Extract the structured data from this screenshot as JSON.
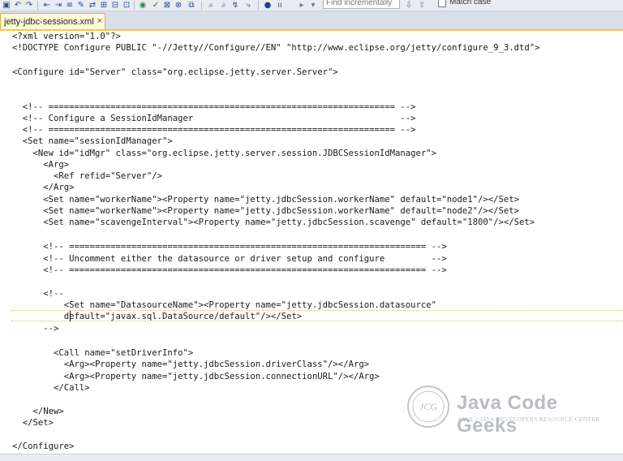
{
  "toolbar": {
    "icons": [
      "save-all",
      "undo",
      "redo",
      "outdent",
      "indent",
      "format",
      "run",
      "check",
      "validate",
      "debug",
      "find",
      "find-replace",
      "bookmark",
      "stop",
      "pause",
      "step"
    ],
    "find_placeholder": "Find incrementally",
    "match_case_label": "Match case"
  },
  "tab": {
    "label": "jetty-jdbc-sessions.xml",
    "close": "×"
  },
  "editor": {
    "lines": [
      "<?xml version=\"1.0\"?>",
      "<!DOCTYPE Configure PUBLIC \"-//Jetty//Configure//EN\" \"http://www.eclipse.org/jetty/configure_9_3.dtd\">",
      "",
      "<Configure id=\"Server\" class=\"org.eclipse.jetty.server.Server\">",
      "",
      "",
      "  <!-- =================================================================== -->",
      "  <!-- Configure a SessionIdManager                                        -->",
      "  <!-- =================================================================== -->",
      "  <Set name=\"sessionIdManager\">",
      "    <New id=\"idMgr\" class=\"org.eclipse.jetty.server.session.JDBCSessionIdManager\">",
      "      <Arg>",
      "        <Ref refid=\"Server\"/>",
      "      </Arg>",
      "      <Set name=\"workerName\"><Property name=\"jetty.jdbcSession.workerName\" default=\"node1\"/></Set>",
      "      <Set name=\"workerName\"><Property name=\"jetty.jdbcSession.workerName\" default=\"node2\"/></Set>",
      "      <Set name=\"scavengeInterval\"><Property name=\"jetty.jdbcSession.scavenge\" default=\"1800\"/></Set>",
      "",
      "      <!-- ===================================================================== -->",
      "      <!-- Uncomment either the datasource or driver setup and configure         -->",
      "      <!-- ===================================================================== -->",
      "",
      "      <!--",
      "          <Set name=\"DatasourceName\"><Property name=\"jetty.jdbcSession.datasource\"",
      "          default=\"javax.sql.DataSource/default\"/></Set>",
      "      -->",
      "",
      "        <Call name=\"setDriverInfo\">",
      "          <Arg><Property name=\"jetty.jdbcSession.driverClass\"/></Arg>",
      "          <Arg><Property name=\"jetty.jdbcSession.connectionURL\"/></Arg>",
      "        </Call>",
      "",
      "    </New>",
      "  </Set>",
      "",
      "</Configure>"
    ]
  },
  "watermark": {
    "logo_text": "JCG",
    "title": "Java Code Geeks",
    "subtitle": "JAVA 2 JAVA DEVELOPERS RESOURCE CENTER"
  }
}
